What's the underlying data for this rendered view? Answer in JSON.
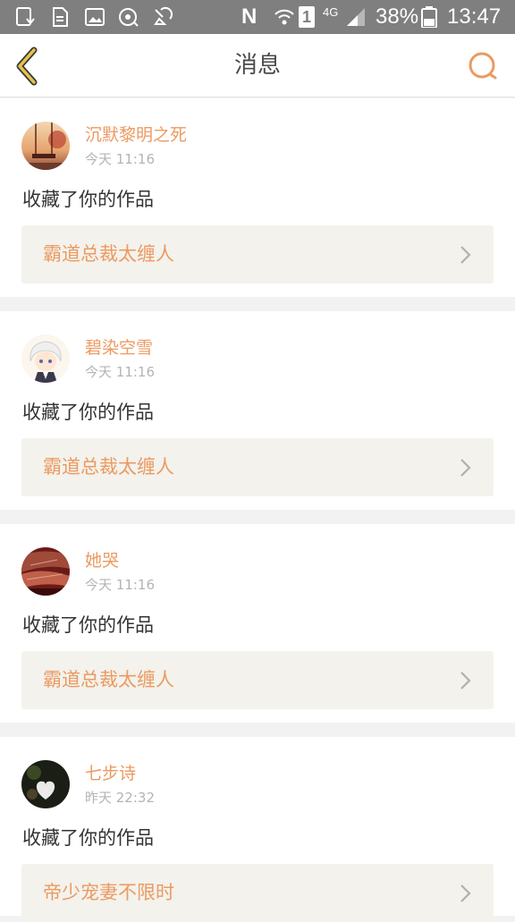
{
  "status_bar": {
    "battery": "38%",
    "time": "13:47",
    "network": "4G",
    "sim": "1",
    "nfc": "N"
  },
  "header": {
    "title": "消息",
    "back_icon": "back-chevron-icon",
    "search_icon": "search-icon"
  },
  "colors": {
    "accent": "#ec9a62",
    "back_accent": "#e8c24a",
    "status_bar": "#7f7f7f",
    "work_box": "#f3f2ec"
  },
  "messages": [
    {
      "user": "沉默黎明之死",
      "time": "今天 11:16",
      "action": "收藏了你的作品",
      "work": "霸道总裁太缠人"
    },
    {
      "user": "碧染空雪",
      "time": "今天 11:16",
      "action": "收藏了你的作品",
      "work": "霸道总裁太缠人"
    },
    {
      "user": "她哭",
      "time": "今天 11:16",
      "action": "收藏了你的作品",
      "work": "霸道总裁太缠人"
    },
    {
      "user": "七步诗",
      "time": "昨天 22:32",
      "action": "收藏了你的作品",
      "work": "帝少宠妻不限时"
    }
  ]
}
